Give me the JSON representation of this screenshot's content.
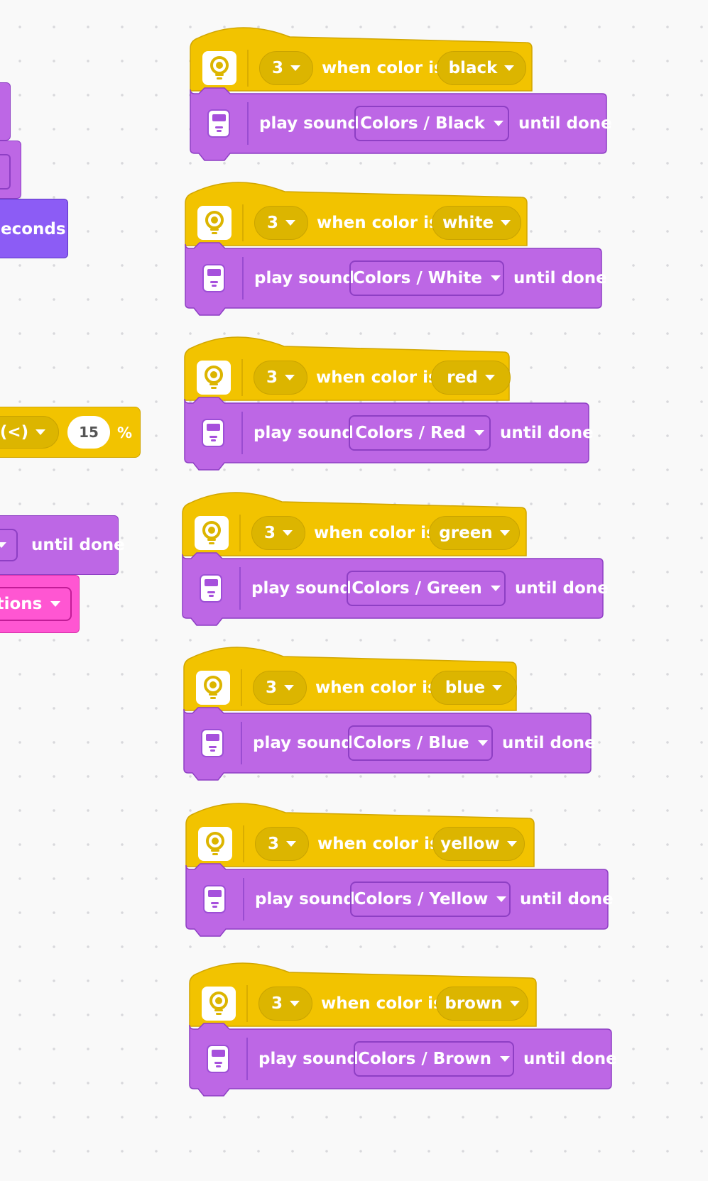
{
  "colors": {
    "event_yellow": "#f2c300",
    "event_dark": "#dcb500",
    "sound_purple": "#bd67e5",
    "sound_border": "#8e3fc4",
    "motor_violet": "#8c5cf5",
    "display_pink": "#ff56d2",
    "canvas": "#f9f9f9"
  },
  "icons": {
    "sensor": "color-sensor-icon",
    "hub": "hub-icon"
  },
  "partial_blocks": {
    "seconds_text": "econds",
    "lt_operator": "(<)",
    "percent_value": "15",
    "percent_sign": "%",
    "until_done": "until done",
    "animations_text": "tions"
  },
  "scripts": [
    {
      "port": "3",
      "hat_text": "when color is",
      "color": "black",
      "play_sound": "play sound",
      "sound": "Colors / Black",
      "until": "until done"
    },
    {
      "port": "3",
      "hat_text": "when color is",
      "color": "white",
      "play_sound": "play sound",
      "sound": "Colors / White",
      "until": "until done"
    },
    {
      "port": "3",
      "hat_text": "when color is",
      "color": "red",
      "play_sound": "play sound",
      "sound": "Colors / Red",
      "until": "until done"
    },
    {
      "port": "3",
      "hat_text": "when color is",
      "color": "green",
      "play_sound": "play sound",
      "sound": "Colors / Green",
      "until": "until done"
    },
    {
      "port": "3",
      "hat_text": "when color is",
      "color": "blue",
      "play_sound": "play sound",
      "sound": "Colors / Blue",
      "until": "until done"
    },
    {
      "port": "3",
      "hat_text": "when color is",
      "color": "yellow",
      "play_sound": "play sound",
      "sound": "Colors / Yellow",
      "until": "until done"
    },
    {
      "port": "3",
      "hat_text": "when color is",
      "color": "brown",
      "play_sound": "play sound",
      "sound": "Colors / Brown",
      "until": "until done"
    }
  ]
}
